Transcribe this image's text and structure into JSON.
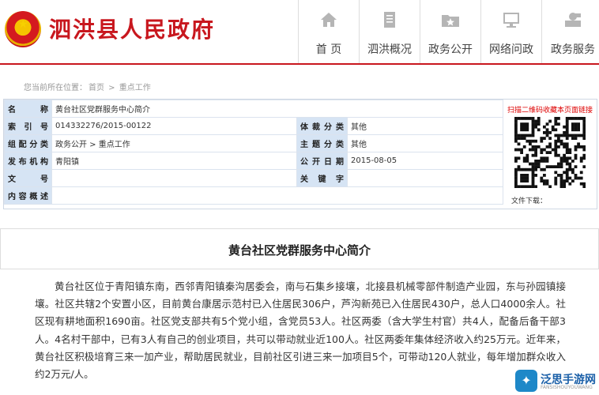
{
  "header": {
    "site_title": "泗洪县人民政府",
    "nav": [
      {
        "label": "首 页",
        "icon": "home-icon"
      },
      {
        "label": "泗洪概况",
        "icon": "document-icon"
      },
      {
        "label": "政务公开",
        "icon": "folder-star-icon"
      },
      {
        "label": "网络问政",
        "icon": "monitor-icon"
      },
      {
        "label": "政务服务",
        "icon": "service-person-icon"
      }
    ]
  },
  "breadcrumb": {
    "prefix": "您当前所在位置：",
    "home": "首页",
    "sep": " > ",
    "current": "重点工作"
  },
  "meta": {
    "name_label": "名　　称",
    "name_value": "黄台社区党群服务中心简介",
    "index_label": "索 引 号",
    "index_value": "014332276/2015-00122",
    "genre_label": "体裁分类",
    "genre_value": "其他",
    "org_cat_label": "组配分类",
    "org_cat_value": "政务公开 > 重点工作",
    "topic_label": "主题分类",
    "topic_value": "其他",
    "publisher_label": "发布机构",
    "publisher_value": "青阳镇",
    "date_label": "公开日期",
    "date_value": "2015-08-05",
    "docno_label": "文　　号",
    "docno_value": "",
    "keyword_label": "关 键 字",
    "keyword_value": "",
    "summary_label": "内容概述",
    "summary_value": "",
    "qr_link": "扫描二维码收藏本页面链接",
    "file_download": "文件下载："
  },
  "article": {
    "title": "黄台社区党群服务中心简介",
    "body": "黄台社区位于青阳镇东南，西邻青阳镇秦沟居委会，南与石集乡接壤，北接县机械零部件制造产业园，东与孙园镇接壤。社区共辖2个安置小区，目前黄台康居示范村已入住居民306户，芦沟新苑已入住居民430户，总人口4000余人。社区现有耕地面积1690亩。社区党支部共有5个党小组，含党员53人。社区两委（含大学生村官）共4人，配备后备干部3人。4名村干部中，已有3人有自己的创业项目，共可以带动就业近100人。社区两委年集体经济收入约25万元。近年来，黄台社区积极培育三来一加产业，帮助居民就业，目前社区引进三来一加项目5个，可带动120人就业，每年增加群众收入约2万元/人。"
  },
  "watermark": {
    "text": "泛思手游网",
    "sub": "FANSISHOUYOUWANG"
  },
  "colors": {
    "brand_red": "#c8171e",
    "label_bg": "#d6e4f4"
  }
}
